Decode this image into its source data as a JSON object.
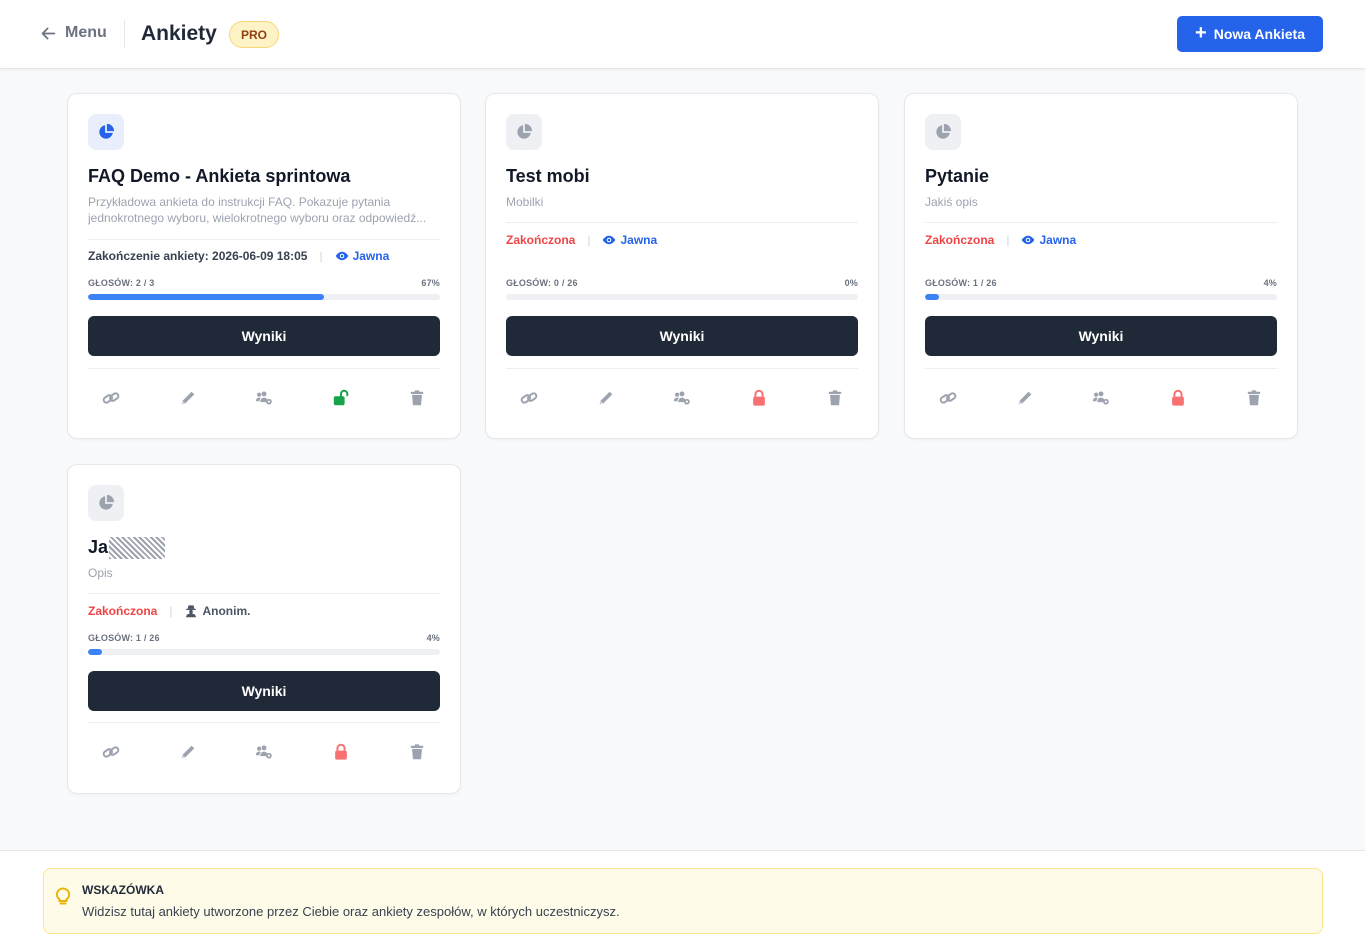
{
  "header": {
    "back_label": "Menu",
    "title": "Ankiety",
    "badge": "PRO",
    "new_button_label": "Nowa Ankieta"
  },
  "cards": [
    {
      "title": "FAQ Demo - Ankieta sprintowa",
      "description": "Przykładowa ankieta do instrukcji FAQ. Pokazuje pytania jednokrotnego wyboru, wielokrotnego wyboru oraz odpowiedź...",
      "status": "Zakończenie ankiety: 2026-06-09 18:05",
      "visibility": "Jawna",
      "votes_label": "GŁOSÓW: 2 / 3",
      "percent_label": "67%",
      "progress": 0.67,
      "results_label": "Wyniki",
      "lock_state": "unlocked"
    },
    {
      "title": "Test mobi",
      "description": "Mobilki",
      "status": "Zakończona",
      "visibility": "Jawna",
      "votes_label": "GŁOSÓW: 0 / 26",
      "percent_label": "0%",
      "progress": 0.0,
      "results_label": "Wyniki",
      "lock_state": "locked"
    },
    {
      "title": "Pytanie",
      "description": "Jakiś opis",
      "status": "Zakończona",
      "visibility": "Jawna",
      "votes_label": "GŁOSÓW: 1 / 26",
      "percent_label": "4%",
      "progress": 0.04,
      "results_label": "Wyniki",
      "lock_state": "locked"
    },
    {
      "title": "Ja",
      "description": "Opis",
      "status": "Zakończona",
      "visibility": "Anonim.",
      "votes_label": "GŁOSÓW: 1 / 26",
      "percent_label": "4%",
      "progress": 0.04,
      "results_label": "Wyniki",
      "lock_state": "locked"
    }
  ],
  "tip": {
    "title": "WSKAZÓWKA",
    "text": "Widzisz tutaj ankiety utworzone przez Ciebie oraz ankiety zespołów, w których uczestniczysz."
  },
  "colors": {
    "primary": "#2563eb",
    "dark_button": "#1f2937",
    "ended": "#ef4444",
    "unlocked": "#16a34a",
    "locked": "#f87171",
    "badge_bg": "#fef3c7"
  },
  "icons": {
    "back": "arrow-left-icon",
    "new": "plus-icon",
    "poll": "pie-chart-icon",
    "visibility_public": "eye-icon",
    "visibility_anon": "user-secret-icon",
    "actions": [
      "link-icon",
      "pencil-icon",
      "users-cog-icon",
      "lock-icon",
      "trash-icon"
    ],
    "tip": "lightbulb-icon"
  }
}
